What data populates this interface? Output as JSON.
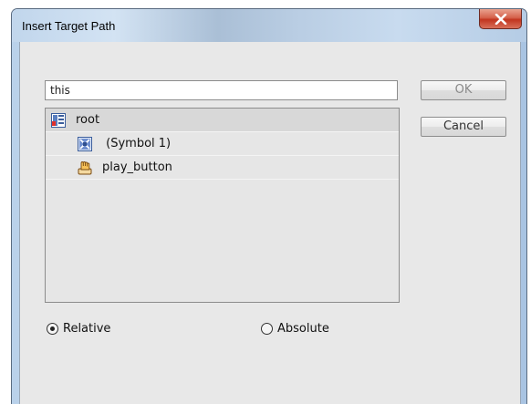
{
  "window": {
    "title": "Insert Target Path"
  },
  "path_input": {
    "value": "this"
  },
  "buttons": {
    "ok_label": "OK",
    "cancel_label": "Cancel"
  },
  "tree": {
    "items": [
      {
        "label": "root",
        "icon": "movieclip-timeline-icon",
        "level": 0,
        "selected": true
      },
      {
        "label": " (Symbol 1)",
        "icon": "movieclip-symbol-icon",
        "level": 1,
        "selected": false
      },
      {
        "label": "play_button",
        "icon": "button-hand-icon",
        "level": 1,
        "selected": false
      }
    ]
  },
  "mode": {
    "relative_label": "Relative",
    "absolute_label": "Absolute",
    "selected": "relative"
  },
  "colors": {
    "close_button": "#c2351f",
    "dialog_background": "#e8e8e8"
  }
}
